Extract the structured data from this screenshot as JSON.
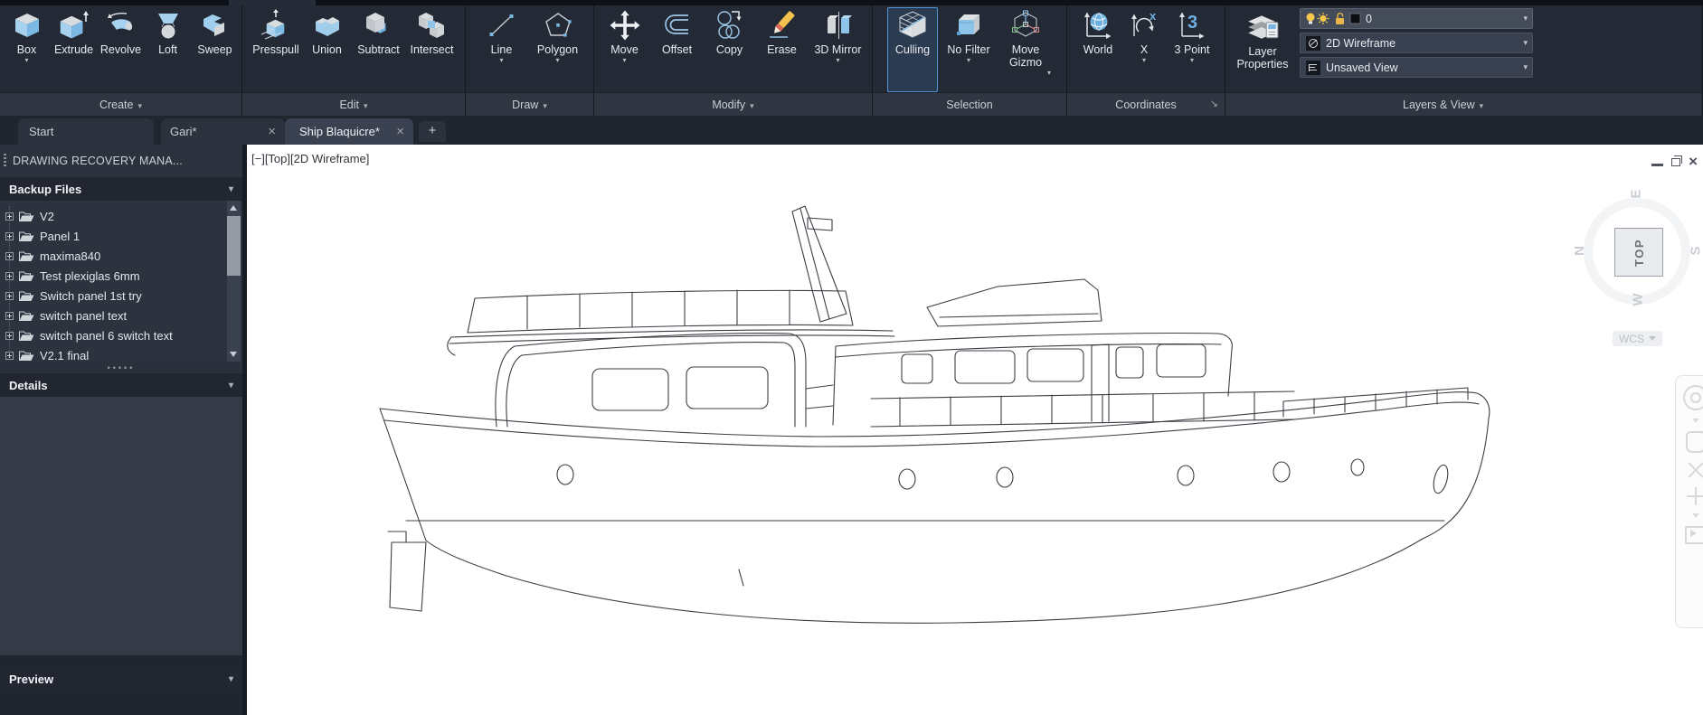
{
  "ribbon": {
    "panels": [
      {
        "title": "Create",
        "buttons": [
          {
            "label": "Box"
          },
          {
            "label": "Extrude"
          },
          {
            "label": "Revolve"
          },
          {
            "label": "Loft"
          },
          {
            "label": "Sweep"
          }
        ]
      },
      {
        "title": "Edit",
        "buttons": [
          {
            "label": "Presspull"
          },
          {
            "label": "Union"
          },
          {
            "label": "Subtract"
          },
          {
            "label": "Intersect"
          }
        ]
      },
      {
        "title": "Draw",
        "buttons": [
          {
            "label": "Line"
          },
          {
            "label": "Polygon"
          }
        ]
      },
      {
        "title": "Modify",
        "buttons": [
          {
            "label": "Move"
          },
          {
            "label": "Offset"
          },
          {
            "label": "Copy"
          },
          {
            "label": "Erase"
          },
          {
            "label": "3D Mirror"
          }
        ]
      },
      {
        "title": "Selection",
        "buttons": [
          {
            "label": "Culling"
          },
          {
            "label": "No Filter"
          },
          {
            "label": "Move Gizmo"
          }
        ]
      },
      {
        "title": "Coordinates",
        "buttons": [
          {
            "label": "World"
          },
          {
            "label": "X"
          },
          {
            "label": "3 Point"
          }
        ]
      },
      {
        "title": "Layers & View",
        "buttons": [
          {
            "label": "Layer Properties"
          }
        ]
      }
    ],
    "layer_combo_value": "0",
    "visual_style_value": "2D Wireframe",
    "view_value": "Unsaved View"
  },
  "tabs": [
    {
      "label": "Start"
    },
    {
      "label": "Gari*"
    },
    {
      "label": "Ship Blaquicre*"
    }
  ],
  "sidebar": {
    "title": "DRAWING RECOVERY MANA...",
    "backup_header": "Backup Files",
    "details_header": "Details",
    "preview_header": "Preview",
    "files": [
      {
        "name": "V2"
      },
      {
        "name": "Panel 1"
      },
      {
        "name": "maxima840"
      },
      {
        "name": "Test plexiglas 6mm"
      },
      {
        "name": "Switch panel 1st try"
      },
      {
        "name": "switch panel text"
      },
      {
        "name": "switch panel 6 switch text"
      },
      {
        "name": "V2.1 final"
      }
    ]
  },
  "viewport": {
    "label": "[−][Top][2D Wireframe]",
    "viewcube": {
      "face": "TOP",
      "n": "N",
      "e": "E",
      "s": "S",
      "w": "W",
      "wcs": "WCS"
    }
  },
  "colors": {
    "accent": "#4f94d8",
    "icon_blue": "#8ec4ea",
    "icon_gray": "#d9dcdf",
    "yellow": "#f6c84b",
    "erase_red": "#e0685a",
    "canvas": "#ffffff",
    "ribbon_bg": "#242a35"
  }
}
